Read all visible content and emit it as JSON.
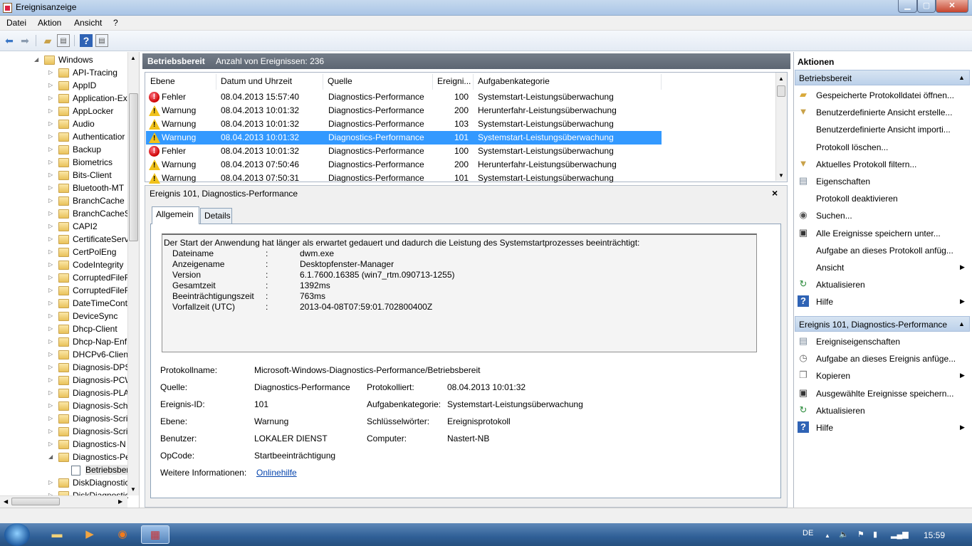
{
  "window": {
    "title": "Ereignisanzeige"
  },
  "menu": {
    "items": [
      "Datei",
      "Aktion",
      "Ansicht",
      "?"
    ]
  },
  "toolbar": {
    "icons": [
      "back-icon",
      "forward-icon",
      "up-icon",
      "show-tree-icon",
      "help-icon",
      "show-actions-icon"
    ]
  },
  "tree": {
    "items": [
      {
        "label": "Windows",
        "expanded": true,
        "level": 0
      },
      {
        "label": "API-Tracing"
      },
      {
        "label": "AppID"
      },
      {
        "label": "Application-Ex"
      },
      {
        "label": "AppLocker"
      },
      {
        "label": "Audio"
      },
      {
        "label": "Authenticatior"
      },
      {
        "label": "Backup"
      },
      {
        "label": "Biometrics"
      },
      {
        "label": "Bits-Client"
      },
      {
        "label": "Bluetooth-MT"
      },
      {
        "label": "BranchCache"
      },
      {
        "label": "BranchCacheS"
      },
      {
        "label": "CAPI2"
      },
      {
        "label": "CertificateServ"
      },
      {
        "label": "CertPolEng"
      },
      {
        "label": "CodeIntegrity"
      },
      {
        "label": "CorruptedFileF"
      },
      {
        "label": "CorruptedFileF"
      },
      {
        "label": "DateTimeCont"
      },
      {
        "label": "DeviceSync"
      },
      {
        "label": "Dhcp-Client"
      },
      {
        "label": "Dhcp-Nap-Enf"
      },
      {
        "label": "DHCPv6-Clien"
      },
      {
        "label": "Diagnosis-DPS"
      },
      {
        "label": "Diagnosis-PCW"
      },
      {
        "label": "Diagnosis-PLA"
      },
      {
        "label": "Diagnosis-Sch"
      },
      {
        "label": "Diagnosis-Scri"
      },
      {
        "label": "Diagnosis-Scri"
      },
      {
        "label": "Diagnostics-N"
      },
      {
        "label": "Diagnostics-Pe",
        "expanded": true
      },
      {
        "label": "Betriebsbere",
        "log": true,
        "selected": true
      },
      {
        "label": "DiskDiagnostic"
      },
      {
        "label": "DiskDiagnostic"
      }
    ]
  },
  "center": {
    "header_title": "Betriebsbereit",
    "header_count": "Anzahl von Ereignissen: 236",
    "columns": [
      "Ebene",
      "Datum und Uhrzeit",
      "Quelle",
      "Ereigni...",
      "Aufgabenkategorie"
    ],
    "rows": [
      {
        "level": "Fehler",
        "type": "error",
        "date": "08.04.2013 15:57:40",
        "source": "Diagnostics-Performance",
        "id": "100",
        "category": "Systemstart-Leistungsüberwachung"
      },
      {
        "level": "Warnung",
        "type": "warning",
        "date": "08.04.2013 10:01:32",
        "source": "Diagnostics-Performance",
        "id": "200",
        "category": "Herunterfahr-Leistungsüberwachung"
      },
      {
        "level": "Warnung",
        "type": "warning",
        "date": "08.04.2013 10:01:32",
        "source": "Diagnostics-Performance",
        "id": "103",
        "category": "Systemstart-Leistungsüberwachung"
      },
      {
        "level": "Warnung",
        "type": "warning",
        "date": "08.04.2013 10:01:32",
        "source": "Diagnostics-Performance",
        "id": "101",
        "category": "Systemstart-Leistungsüberwachung",
        "selected": true
      },
      {
        "level": "Fehler",
        "type": "error",
        "date": "08.04.2013 10:01:32",
        "source": "Diagnostics-Performance",
        "id": "100",
        "category": "Systemstart-Leistungsüberwachung"
      },
      {
        "level": "Warnung",
        "type": "warning",
        "date": "08.04.2013 07:50:46",
        "source": "Diagnostics-Performance",
        "id": "200",
        "category": "Herunterfahr-Leistungsüberwachung"
      },
      {
        "level": "Warnung",
        "type": "warning",
        "date": "08.04.2013 07:50:31",
        "source": "Diagnostics-Performance",
        "id": "101",
        "category": "Systemstart-Leistungsüberwachung"
      }
    ]
  },
  "detail": {
    "title": "Ereignis 101, Diagnostics-Performance",
    "close": "×",
    "tabs": [
      "Allgemein",
      "Details"
    ],
    "message_intro": "Der Start der Anwendung hat länger als erwartet gedauert und dadurch die Leistung des Systemstartprozesses beeinträchtigt:",
    "message_fields": [
      {
        "name": "Dateiname",
        "value": "dwm.exe"
      },
      {
        "name": "Anzeigename",
        "value": "Desktopfenster-Manager"
      },
      {
        "name": "Version",
        "value": "6.1.7600.16385 (win7_rtm.090713-1255)"
      },
      {
        "name": "Gesamtzeit",
        "value": "1392ms"
      },
      {
        "name": "Beeinträchtigungszeit",
        "value": "763ms"
      },
      {
        "name": "Vorfallzeit (UTC)",
        "value": "2013-04-08T07:59:01.702800400Z"
      }
    ],
    "colon": ":",
    "props": {
      "protokollname_label": "Protokollname:",
      "protokollname": "Microsoft-Windows-Diagnostics-Performance/Betriebsbereit",
      "quelle_label": "Quelle:",
      "quelle": "Diagnostics-Performance",
      "protokolliert_label": "Protokolliert:",
      "protokolliert": "08.04.2013 10:01:32",
      "ereignisid_label": "Ereignis-ID:",
      "ereignisid": "101",
      "aufgabenkategorie_label": "Aufgabenkategorie:",
      "aufgabenkategorie": "Systemstart-Leistungsüberwachung",
      "ebene_label": "Ebene:",
      "ebene": "Warnung",
      "schluesselwoerter_label": "Schlüsselwörter:",
      "schluesselwoerter": "Ereignisprotokoll",
      "benutzer_label": "Benutzer:",
      "benutzer": "LOKALER DIENST",
      "computer_label": "Computer:",
      "computer": "Nastert-NB",
      "opcode_label": "OpCode:",
      "opcode": "Startbeeinträchtigung",
      "weitere_label": "Weitere Informationen:",
      "weitere_link": "Onlinehilfe"
    }
  },
  "actions": {
    "title": "Aktionen",
    "section1": {
      "label": "Betriebsbereit",
      "items": [
        {
          "label": "Gespeicherte Protokolldatei öffnen...",
          "icon": "open-folder-icon"
        },
        {
          "label": "Benutzerdefinierte Ansicht erstelle...",
          "icon": "filter-icon"
        },
        {
          "label": "Benutzerdefinierte Ansicht importi...",
          "icon": ""
        },
        {
          "label": "Protokoll löschen...",
          "icon": ""
        },
        {
          "label": "Aktuelles Protokoll filtern...",
          "icon": "filter-icon"
        },
        {
          "label": "Eigenschaften",
          "icon": "properties-icon"
        },
        {
          "label": "Protokoll deaktivieren",
          "icon": ""
        },
        {
          "label": "Suchen...",
          "icon": "binoculars-icon"
        },
        {
          "label": "Alle Ereignisse speichern unter...",
          "icon": "save-icon"
        },
        {
          "label": "Aufgabe an dieses Protokoll anfüg...",
          "icon": ""
        },
        {
          "label": "Ansicht",
          "icon": "",
          "submenu": true
        },
        {
          "label": "Aktualisieren",
          "icon": "refresh-icon"
        },
        {
          "label": "Hilfe",
          "icon": "help-icon",
          "submenu": true
        }
      ]
    },
    "section2": {
      "label": "Ereignis 101, Diagnostics-Performance",
      "items": [
        {
          "label": "Ereigniseigenschaften",
          "icon": "properties-icon"
        },
        {
          "label": "Aufgabe an dieses Ereignis anfüge...",
          "icon": "task-icon"
        },
        {
          "label": "Kopieren",
          "icon": "copy-icon",
          "submenu": true
        },
        {
          "label": "Ausgewählte Ereignisse speichern...",
          "icon": "save-icon"
        },
        {
          "label": "Aktualisieren",
          "icon": "refresh-icon"
        },
        {
          "label": "Hilfe",
          "icon": "help-icon",
          "submenu": true
        }
      ]
    }
  },
  "taskbar": {
    "lang": "DE",
    "clock": "15:59",
    "apps": [
      "explorer-icon",
      "media-player-icon",
      "firefox-icon",
      "event-viewer-icon"
    ]
  }
}
